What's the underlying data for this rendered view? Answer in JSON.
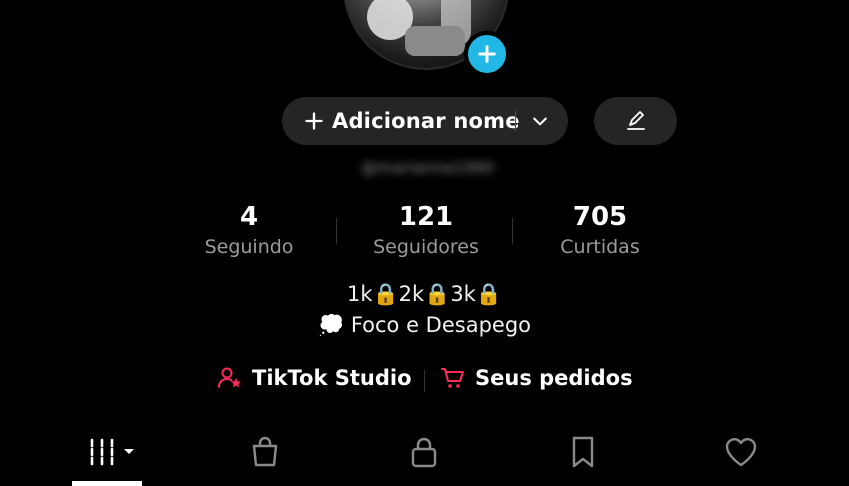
{
  "profile": {
    "add_name_label": "Adicionar nome",
    "username": "@marianna1990"
  },
  "stats": [
    {
      "value": "4",
      "label": "Seguindo"
    },
    {
      "value": "121",
      "label": "Seguidores"
    },
    {
      "value": "705",
      "label": "Curtidas"
    }
  ],
  "bio": {
    "line1": "1k🔒2k🔒3k🔒",
    "line2": "💭 Foco e Desapego"
  },
  "links": {
    "studio": "TikTok Studio",
    "orders": "Seus pedidos"
  },
  "tabs": {
    "items": [
      {
        "icon": "grid-icon",
        "active": true
      },
      {
        "icon": "shopping-bag-icon",
        "active": false
      },
      {
        "icon": "lock-icon",
        "active": false
      },
      {
        "icon": "bookmark-icon",
        "active": false
      },
      {
        "icon": "heart-icon",
        "active": false
      }
    ]
  },
  "colors": {
    "background": "#000000",
    "pill": "#252525",
    "accent_blue": "#22b8e6",
    "accent_red": "#fe2c55",
    "muted_text": "#9b9b9b"
  }
}
